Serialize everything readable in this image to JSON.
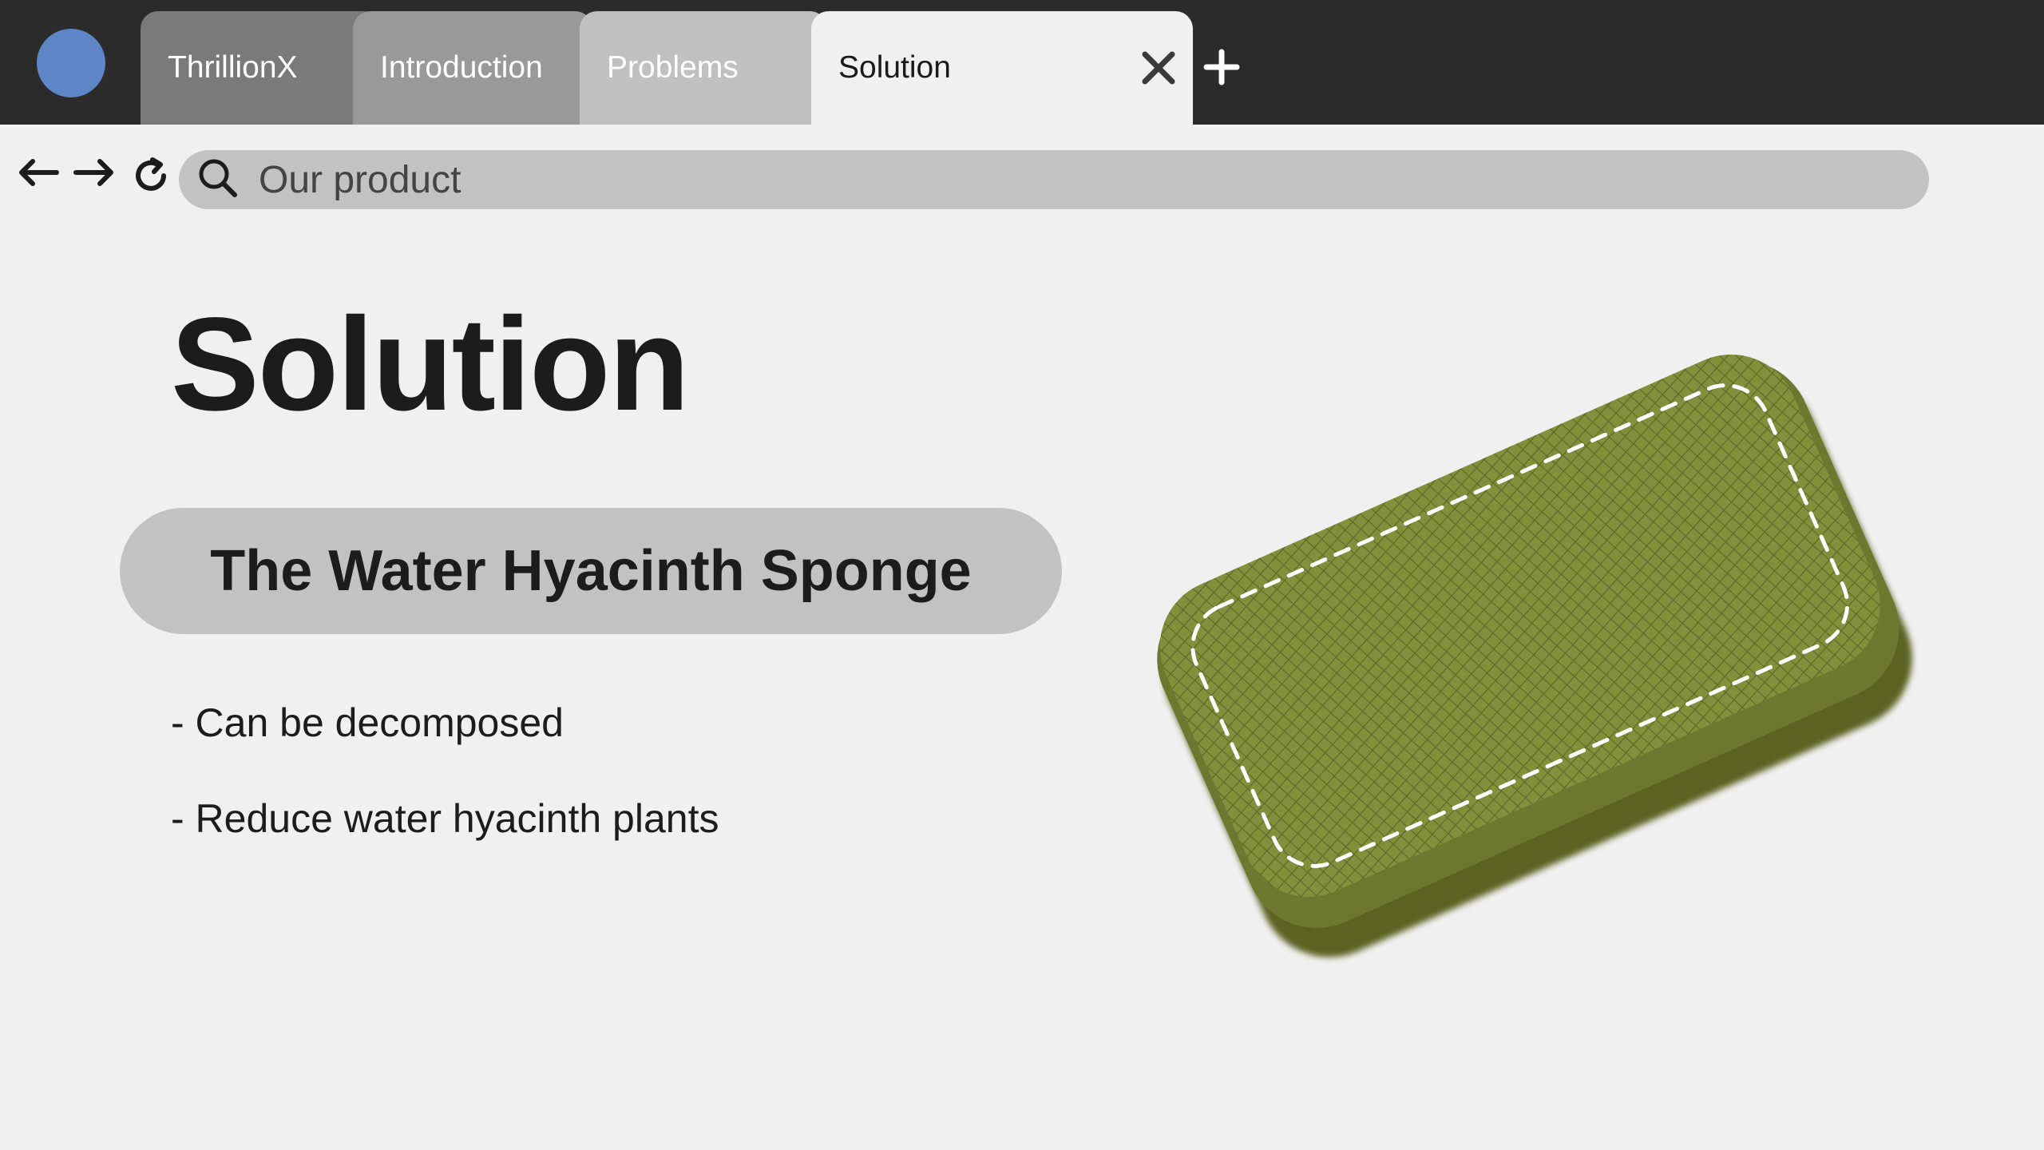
{
  "browser": {
    "tabs": [
      {
        "label": "ThrillionX"
      },
      {
        "label": "Introduction"
      },
      {
        "label": "Problems"
      },
      {
        "label": "Solution",
        "active": true
      }
    ],
    "address": {
      "value": "Our product"
    }
  },
  "slide": {
    "title": "Solution",
    "product_name": "The Water Hyacinth Sponge",
    "bullets": [
      "- Can be decomposed",
      "- Reduce water hyacinth plants"
    ]
  },
  "icons": {
    "profile": "profile-dot-icon",
    "close": "close-icon",
    "new_tab": "plus-icon",
    "back": "arrow-left-icon",
    "forward": "arrow-right-icon",
    "reload": "reload-icon",
    "search": "search-icon"
  },
  "colors": {
    "tab_bar": "#2b2b2b",
    "profile_dot": "#5e85c5",
    "active_tab": "#f0f0f0",
    "pill": "#c2c2c2",
    "sponge_green": "#7d8c3a"
  }
}
